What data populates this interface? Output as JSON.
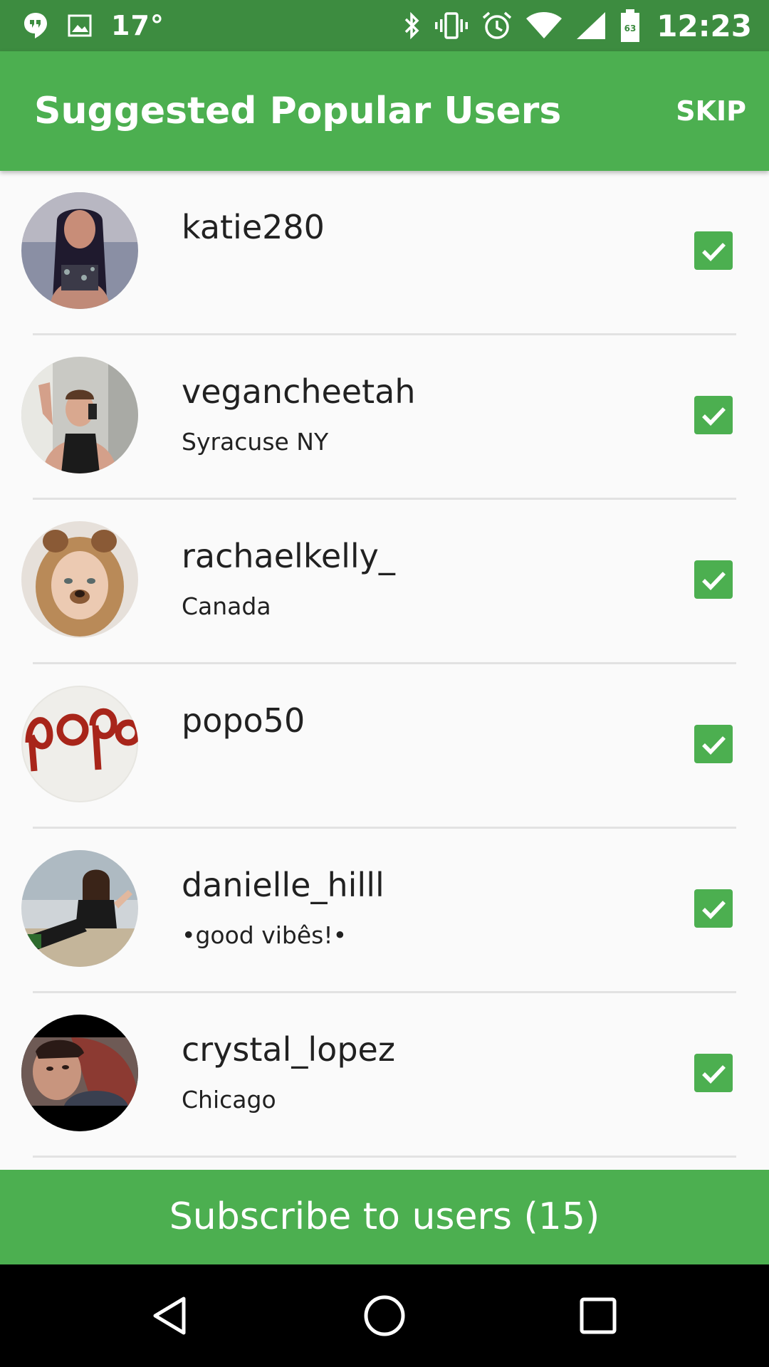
{
  "status_bar": {
    "temperature": "17°",
    "time": "12:23",
    "battery_level": "63",
    "icons": [
      "hangouts-icon",
      "image-icon",
      "bluetooth-icon",
      "vibrate-icon",
      "alarm-icon",
      "wifi-icon",
      "signal-icon",
      "battery-icon"
    ]
  },
  "app_bar": {
    "title": "Suggested Popular Users",
    "skip_label": "SKIP"
  },
  "users": [
    {
      "username": "katie280",
      "subtitle": "",
      "checked": true
    },
    {
      "username": "vegancheetah",
      "subtitle": "Syracuse NY",
      "checked": true
    },
    {
      "username": "rachaelkelly_",
      "subtitle": "Canada",
      "checked": true
    },
    {
      "username": "popo50",
      "subtitle": "",
      "checked": true
    },
    {
      "username": "danielle_hilll",
      "subtitle": "•good vibês!•",
      "checked": true
    },
    {
      "username": "crystal_lopez",
      "subtitle": "Chicago",
      "checked": true
    }
  ],
  "subscribe": {
    "label": "Subscribe to users (15)"
  },
  "nav_bar": {
    "icons": [
      "back-icon",
      "home-icon",
      "recents-icon"
    ]
  },
  "colors": {
    "status_bar": "#3d8c40",
    "app_bar": "#4caf50",
    "accent": "#4caf50",
    "text_primary": "#212121",
    "background": "#fafafa",
    "divider": "#e2e2e2"
  }
}
